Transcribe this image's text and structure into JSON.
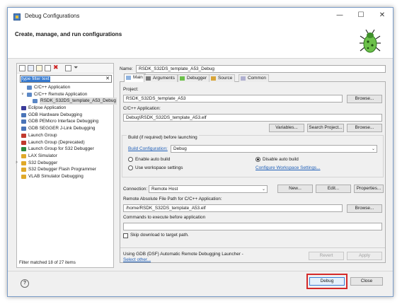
{
  "window": {
    "title": "Debug Configurations",
    "header": "Create, manage, and run configurations",
    "controls": [
      "—",
      "☐",
      "✕"
    ]
  },
  "left": {
    "filter_text": "type filter text",
    "tree": [
      {
        "label": "C/C++ Application",
        "indent": 1,
        "twisty": "",
        "icon": "c-app-icon",
        "color": "#5b88c6"
      },
      {
        "label": "C/C++ Remote Application",
        "indent": 1,
        "twisty": "∨",
        "icon": "c-remote-icon",
        "color": "#5b88c6"
      },
      {
        "label": "RSDK_S32DS_template_A53_Debug",
        "indent": 2,
        "twisty": "",
        "icon": "c-remote-icon",
        "color": "#5b88c6",
        "selected": true
      },
      {
        "label": "Eclipse Application",
        "indent": 0,
        "twisty": "",
        "icon": "eclipse-icon",
        "color": "#3b3b9a"
      },
      {
        "label": "GDB Hardware Debugging",
        "indent": 0,
        "twisty": "",
        "icon": "gdb-icon",
        "color": "#4a74b8"
      },
      {
        "label": "GDB PEMicro Interface Debugging",
        "indent": 0,
        "twisty": "",
        "icon": "gdb-icon",
        "color": "#4a74b8"
      },
      {
        "label": "GDB SEGGER J-Link Debugging",
        "indent": 0,
        "twisty": "",
        "icon": "gdb-icon",
        "color": "#4a74b8"
      },
      {
        "label": "Launch Group",
        "indent": 0,
        "twisty": "",
        "icon": "launch-group-icon",
        "color": "#c23a2e"
      },
      {
        "label": "Launch Group (Deprecated)",
        "indent": 0,
        "twisty": "",
        "icon": "launch-group-icon",
        "color": "#c23a2e"
      },
      {
        "label": "Launch Group for S32 Debugger",
        "indent": 0,
        "twisty": "",
        "icon": "launch-group-icon",
        "color": "#2e8a3e"
      },
      {
        "label": "LAX Simulator",
        "indent": 0,
        "twisty": "",
        "icon": "simulator-icon",
        "color": "#e0a92a"
      },
      {
        "label": "S32 Debugger",
        "indent": 0,
        "twisty": ">",
        "icon": "s32-debugger-icon",
        "color": "#e0a92a"
      },
      {
        "label": "S32 Debugger Flash Programmer",
        "indent": 0,
        "twisty": "",
        "icon": "flash-icon",
        "color": "#e0a92a"
      },
      {
        "label": "VLAB Simulator Debugging",
        "indent": 0,
        "twisty": "",
        "icon": "simulator-icon",
        "color": "#e0a92a"
      }
    ],
    "footer": "Filter matched 18 of 27 items"
  },
  "right": {
    "name_label": "Name:",
    "name_value": "RSDK_S32DS_template_A53_Debug",
    "tabs": [
      {
        "label": "Main",
        "icon": "main-tab-icon",
        "active": true
      },
      {
        "label": "Arguments",
        "icon": "arguments-tab-icon"
      },
      {
        "label": "Debugger",
        "icon": "debugger-tab-icon"
      },
      {
        "label": "Source",
        "icon": "source-tab-icon"
      },
      {
        "label": "Common",
        "icon": "common-tab-icon"
      }
    ],
    "project_label": "Project:",
    "project_value": "RSDK_S32DS_template_A53",
    "browse": "Browse...",
    "app_label": "C/C++ Application:",
    "app_value": "Debug\\RSDK_S32DS_template_A53.elf",
    "variables": "Variables...",
    "search_project": "Search Project...",
    "build_group": "Build (if required) before launching",
    "build_config_link": "Build Configuration:",
    "build_config_value": "Debug",
    "enable_auto": "Enable auto build",
    "disable_auto": "Disable auto build",
    "use_workspace": "Use workspace settings",
    "configure_workspace": "Configure Workspace Settings...",
    "connection_label": "Connection:",
    "connection_value": "Remote Host",
    "new": "New...",
    "edit": "Edit...",
    "properties": "Properties...",
    "remote_path_label": "Remote Absolute File Path for C/C++ Application:",
    "remote_path_value": "/home/RSDK_S32DS_template_A53.elf",
    "commands_label": "Commands to execute before application",
    "commands_value": "",
    "skip_download": "Skip download to target path.",
    "launcher_text": "Using GDB (DSF) Automatic Remote Debugging Launcher -",
    "select_other": "Select other...",
    "revert": "Revert",
    "apply": "Apply"
  },
  "bottom": {
    "help": "?",
    "debug": "Debug",
    "close": "Close"
  }
}
